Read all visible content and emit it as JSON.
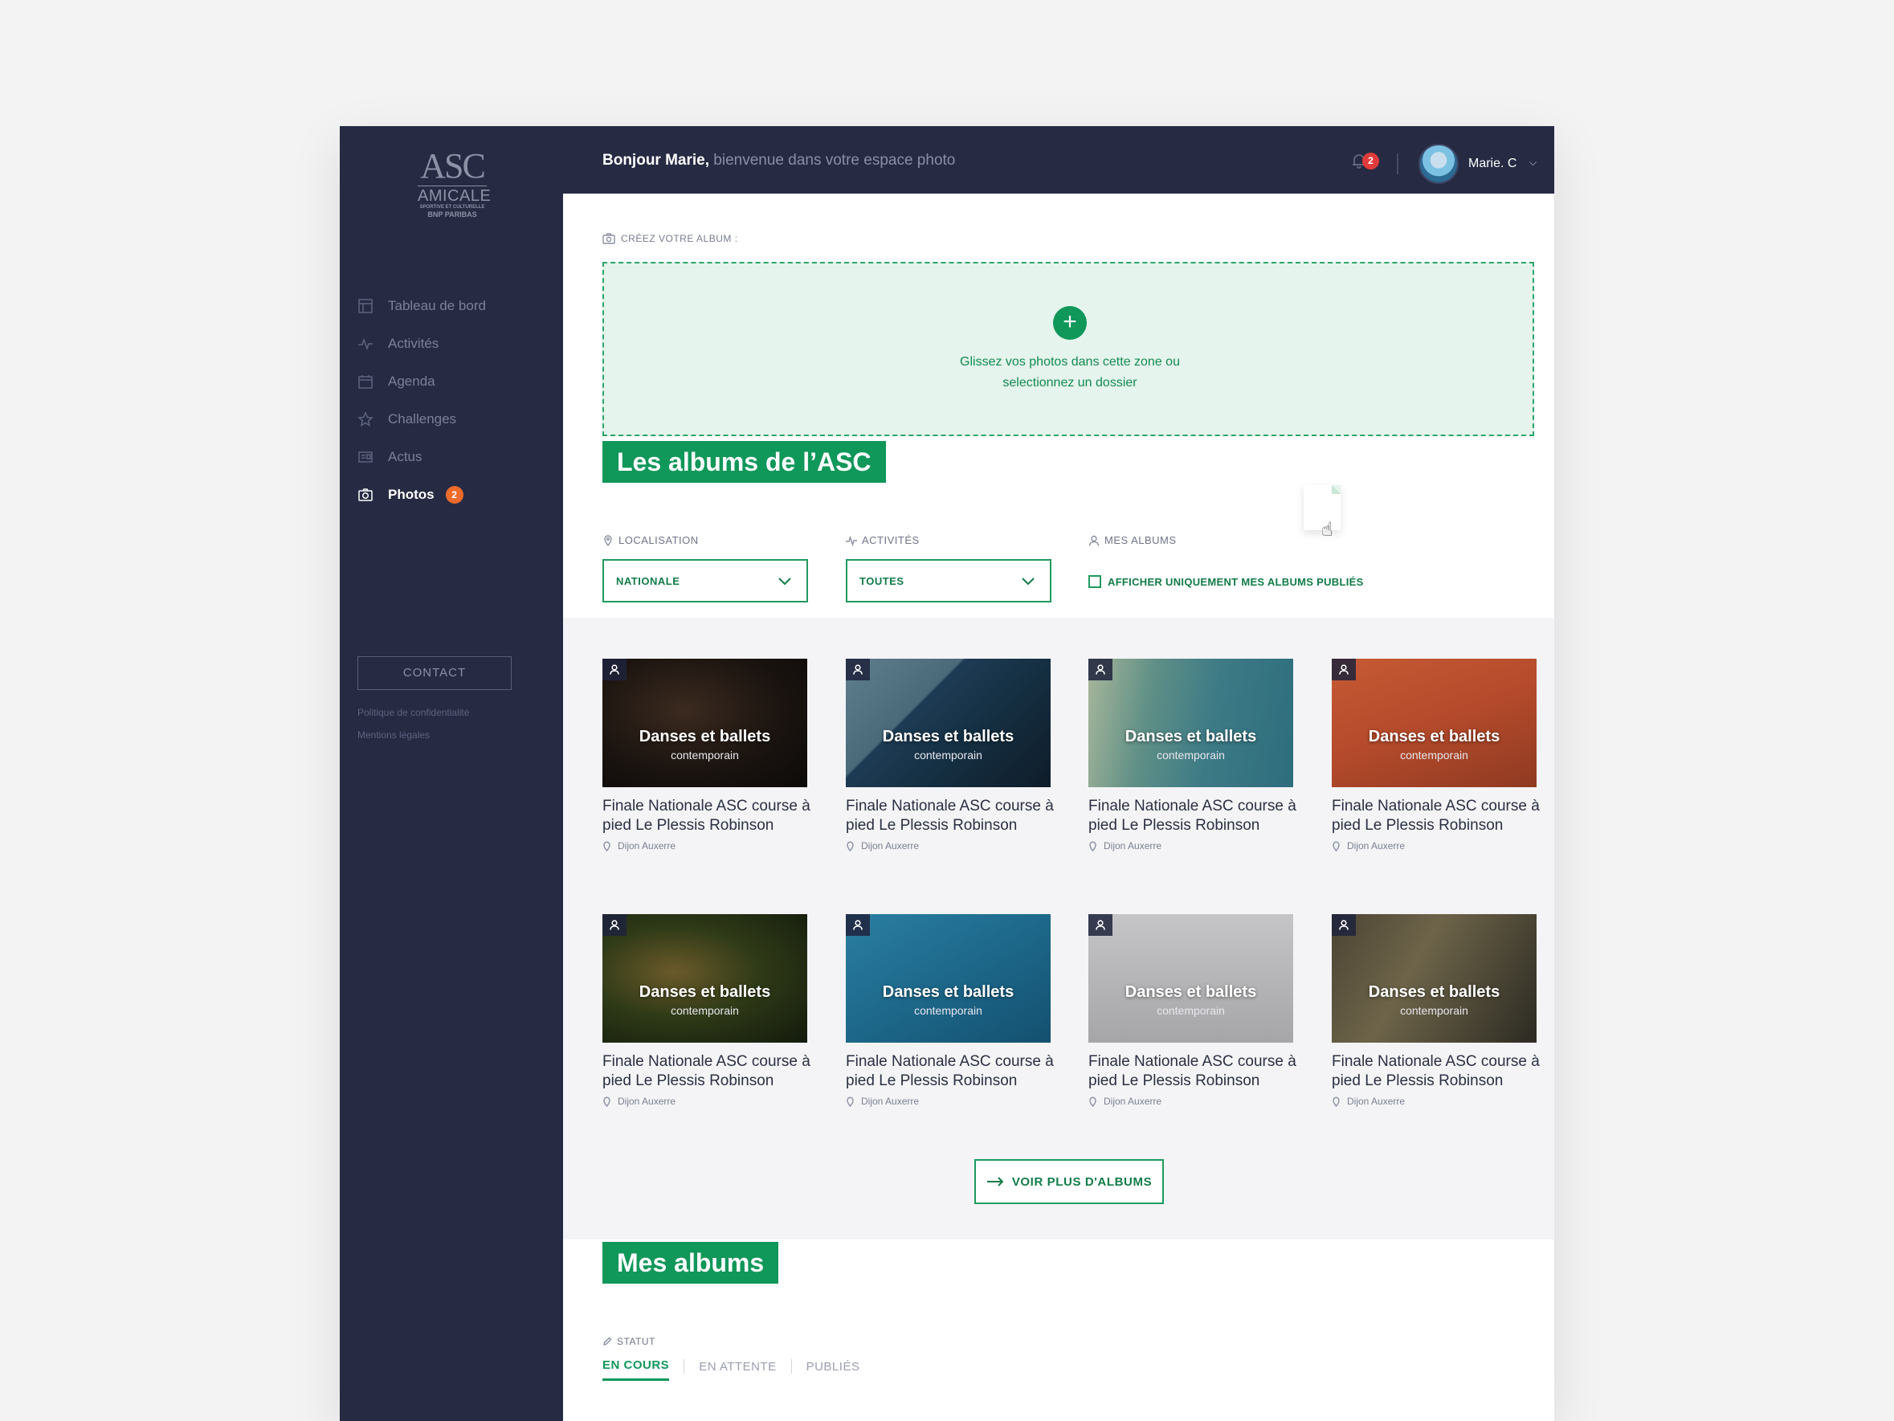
{
  "sidebar": {
    "logo": {
      "line1": "ASC",
      "line2": "AMICALE",
      "line3": "SPORTIVE ET CULTURELLE",
      "line4": "BNP PARIBAS"
    },
    "nav": [
      {
        "label": "Tableau de bord",
        "icon": "dashboard-icon"
      },
      {
        "label": "Activités",
        "icon": "activity-pulse-icon"
      },
      {
        "label": "Agenda",
        "icon": "calendar-icon"
      },
      {
        "label": "Challenges",
        "icon": "star-icon"
      },
      {
        "label": "Actus",
        "icon": "news-icon"
      },
      {
        "label": "Photos",
        "icon": "camera-icon",
        "badge": "2",
        "active": true
      }
    ],
    "contact_label": "CONTACT",
    "privacy_link": "Politique de confidentialité",
    "legal_link": "Mentions légales"
  },
  "header": {
    "greeting_bold": "Bonjour Marie,",
    "greeting_rest": " bienvenue dans votre espace photo",
    "notif_count": "2",
    "user_name": "Marie. C"
  },
  "create": {
    "label": "CRÉEZ VOTRE ALBUM :",
    "plus": "+",
    "drop_line1": "Glissez vos photos dans cette zone ou",
    "drop_line2": "selectionnez un dossier"
  },
  "albums_section": {
    "title": "Les albums de l’ASC",
    "filters": {
      "location_label": "LOCALISATION",
      "location_value": "NATIONALE",
      "activities_label": "ACTIVITÉS",
      "activities_value": "TOUTES",
      "mine_label": "MES ALBUMS",
      "mine_checkbox": "AFFICHER UNIQUEMENT MES ALBUMS PUBLIÉS"
    },
    "cards": [
      {
        "overlay_title": "Danses et ballets",
        "overlay_sub": "contemporain",
        "title": "Finale Nationale ASC course à pied Le Plessis Robinson",
        "location": "Dijon Auxerre"
      },
      {
        "overlay_title": "Danses et ballets",
        "overlay_sub": "contemporain",
        "title": "Finale Nationale ASC course à pied Le Plessis Robinson",
        "location": "Dijon Auxerre"
      },
      {
        "overlay_title": "Danses et ballets",
        "overlay_sub": "contemporain",
        "title": "Finale Nationale ASC course à pied Le Plessis Robinson",
        "location": "Dijon Auxerre"
      },
      {
        "overlay_title": "Danses et ballets",
        "overlay_sub": "contemporain",
        "title": "Finale Nationale ASC course à pied Le Plessis Robinson",
        "location": "Dijon Auxerre"
      },
      {
        "overlay_title": "Danses et ballets",
        "overlay_sub": "contemporain",
        "title": "Finale Nationale ASC course à pied Le Plessis Robinson",
        "location": "Dijon Auxerre"
      },
      {
        "overlay_title": "Danses et ballets",
        "overlay_sub": "contemporain",
        "title": "Finale Nationale ASC course à pied Le Plessis Robinson",
        "location": "Dijon Auxerre"
      },
      {
        "overlay_title": "Danses et ballets",
        "overlay_sub": "contemporain",
        "title": "Finale Nationale ASC course à pied Le Plessis Robinson",
        "location": "Dijon Auxerre"
      },
      {
        "overlay_title": "Danses et ballets",
        "overlay_sub": "contemporain",
        "title": "Finale Nationale ASC course à pied Le Plessis Robinson",
        "location": "Dijon Auxerre"
      }
    ],
    "more_label": "VOIR PLUS D'ALBUMS"
  },
  "my_albums": {
    "title": "Mes albums",
    "status_label": "STATUT",
    "tabs": [
      "EN COURS",
      "EN ATTENTE",
      "PUBLIÉS"
    ],
    "active_tab": "EN COURS"
  },
  "colors": {
    "sidebar_bg": "#262b43",
    "accent_green": "#10975a",
    "badge_orange": "#ee6b2b",
    "notif_red": "#e33b3b"
  }
}
